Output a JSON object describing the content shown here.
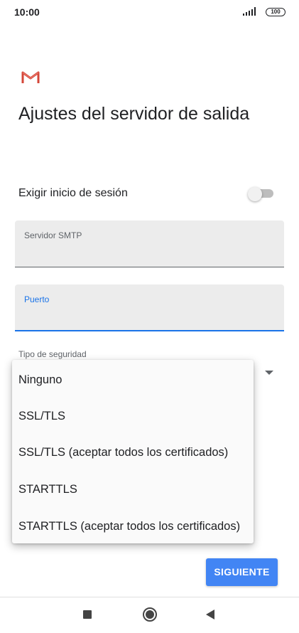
{
  "status_bar": {
    "time": "10:00",
    "battery": "100",
    "icons": [
      "signal-icon",
      "battery-icon"
    ]
  },
  "header": {
    "logo": "gmail-logo",
    "title": "Ajustes del servidor de salida"
  },
  "require_signin": {
    "label": "Exigir inicio de sesión",
    "enabled": false
  },
  "fields": {
    "smtp_server": {
      "label": "Servidor SMTP",
      "value": ""
    },
    "port": {
      "label": "Puerto",
      "value": ""
    }
  },
  "security": {
    "label": "Tipo de seguridad",
    "options": [
      "Ninguno",
      "SSL/TLS",
      "SSL/TLS (aceptar todos los certificados)",
      "STARTTLS",
      "STARTTLS (aceptar todos los certificados)"
    ]
  },
  "actions": {
    "next_label": "SIGUIENTE"
  },
  "colors": {
    "accent": "#1a73e8",
    "button": "#4285f4",
    "gmail_red": "#d44638"
  },
  "nav": {
    "icons": [
      "recent-apps-icon",
      "home-icon",
      "back-icon"
    ]
  }
}
